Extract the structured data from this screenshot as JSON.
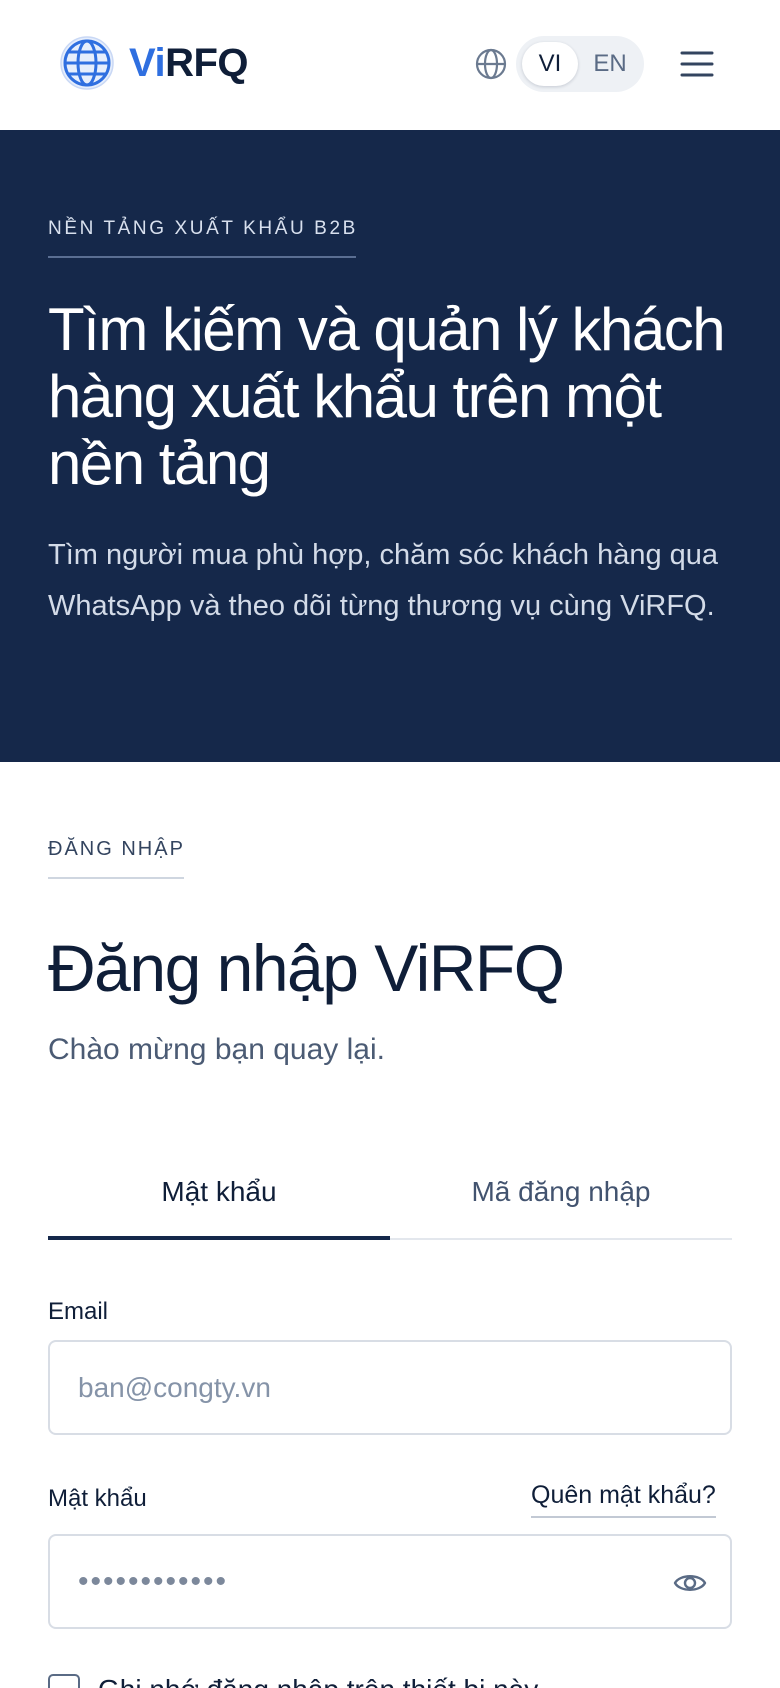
{
  "header": {
    "logo_prefix": "Vi",
    "logo_suffix": "RFQ",
    "lang_options": [
      "VI",
      "EN"
    ],
    "lang_selected": "VI"
  },
  "hero": {
    "eyebrow": "NỀN TẢNG XUẤT KHẨU B2B",
    "title": "Tìm kiếm và quản lý khách hàng xuất khẩu trên một nền tảng",
    "subtitle": "Tìm người mua phù hợp, chăm sóc khách hàng qua WhatsApp và theo dõi từng thương vụ cùng ViRFQ."
  },
  "login": {
    "eyebrow": "ĐĂNG NHẬP",
    "title": "Đăng nhập ViRFQ",
    "subtitle": "Chào mừng bạn quay lại.",
    "tabs": [
      {
        "label": "Mật khẩu",
        "active": true
      },
      {
        "label": "Mã đăng nhập",
        "active": false
      }
    ],
    "email": {
      "label": "Email",
      "placeholder": "ban@congty.vn",
      "value": ""
    },
    "password": {
      "label": "Mật khẩu",
      "forgot_label": "Quên mật khẩu?",
      "masked_value": "••••••••••••"
    },
    "remember_label": "Ghi nhớ đăng nhập trên thiết bị này"
  },
  "colors": {
    "brand_navy": "#15284a",
    "brand_blue": "#2f6fe0"
  },
  "icons": {
    "logo": "globe-logo-icon",
    "language": "globe-icon",
    "menu": "hamburger-menu-icon",
    "password_toggle": "eye-icon"
  }
}
